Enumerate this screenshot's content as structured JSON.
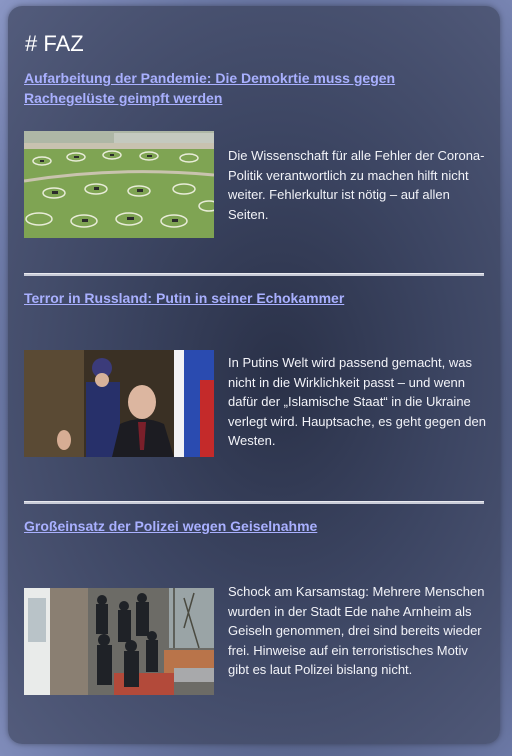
{
  "feed": {
    "title": "# FAZ",
    "articles": [
      {
        "headline": "Aufarbeitung der Pandemie: Die Demokrtie muss gegen Rachegelüste geimpft werden",
        "description": "Die Wissenschaft für alle Fehler der Corona-Politik verantwortlich zu machen hilft nicht weiter. Fehlerkultur ist nötig – auf allen Seiten.",
        "image": "park-social-distancing-circles"
      },
      {
        "headline": "Terror in Russland: Putin in seiner Echokammer",
        "description": "In Putins Welt wird passend gemacht, was nicht in die Wirklichkeit passt – und wenn dafür der „Islamische Staat“ in die Ukraine verlegt wird. Hauptsache, es geht gegen den Westen.",
        "image": "putin-speech-with-guard"
      },
      {
        "headline": "Großeinsatz der Polizei wegen Geiselnahme",
        "description": "Schock am Karsamstag: Mehrere Menschen wurden in der Stadt Ede nahe Arnheim als Geiseln genommen, drei sind bereits wieder frei. Hinweise auf ein terroristisches Motiv gibt es laut Polizei bislang nicht.",
        "image": "police-officers-street"
      }
    ]
  }
}
